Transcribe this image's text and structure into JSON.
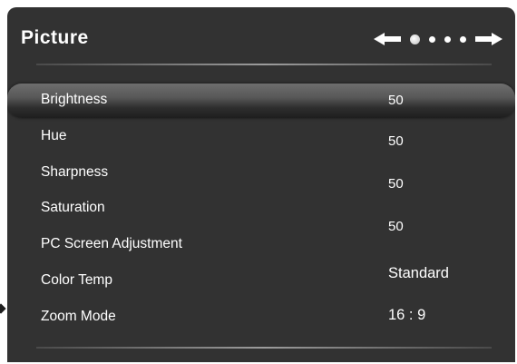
{
  "menu": {
    "title": "Picture",
    "items": [
      {
        "label": "Brightness"
      },
      {
        "label": "Hue"
      },
      {
        "label": "Sharpness"
      },
      {
        "label": "Saturation"
      },
      {
        "label": "PC Screen Adjustment"
      },
      {
        "label": "Color Temp"
      },
      {
        "label": "Zoom Mode"
      }
    ],
    "values": [
      "50",
      "50",
      "50",
      "50",
      "Standard",
      "16 : 9"
    ],
    "selected_item": "Brightness"
  },
  "pager": {
    "pages": 4,
    "current_page": 1,
    "left_icon": "left-arrow-icon",
    "right_icon": "right-arrow-icon"
  },
  "colors": {
    "panel_background": "#323232",
    "text": "#ffffff",
    "highlight": "#585858"
  }
}
